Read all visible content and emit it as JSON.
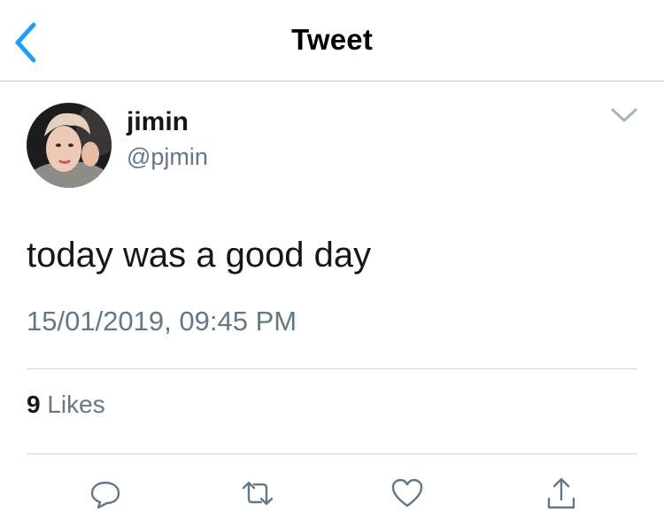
{
  "nav": {
    "title": "Tweet",
    "back_icon": "chevron-left-icon",
    "accent_color": "#1da1f2"
  },
  "tweet": {
    "author": {
      "name": "jimin",
      "handle": "@pjmin",
      "avatar": "profile-photo"
    },
    "menu_icon": "chevron-down-icon",
    "text": "today was a good day",
    "timestamp": "15/01/2019, 09:45 PM",
    "likes": {
      "count": "9",
      "label": "Likes"
    },
    "actions": [
      {
        "name": "reply",
        "icon": "reply-icon"
      },
      {
        "name": "retweet",
        "icon": "retweet-icon"
      },
      {
        "name": "like",
        "icon": "heart-icon"
      },
      {
        "name": "share",
        "icon": "share-icon"
      }
    ]
  },
  "colors": {
    "text_primary": "#14171a",
    "text_secondary": "#657786",
    "divider": "#cfd5da",
    "icon_gray": "#657786"
  }
}
